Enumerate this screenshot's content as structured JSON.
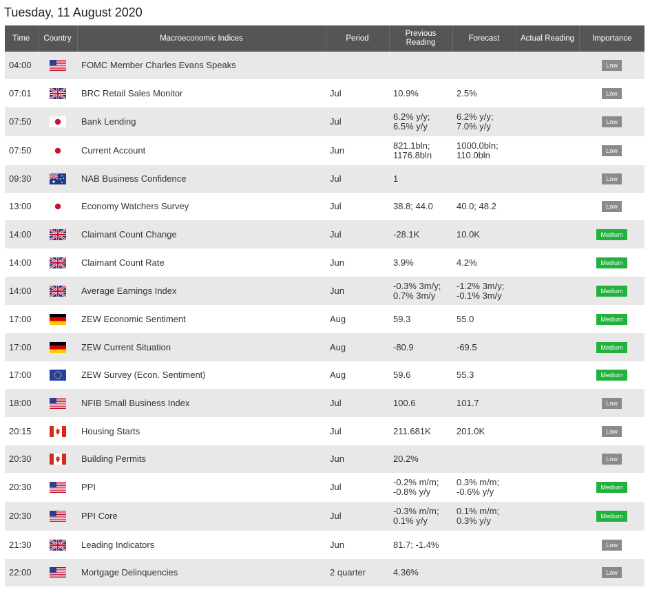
{
  "date_title": "Tuesday, 11 August 2020",
  "colors": {
    "header_bg": "#555555",
    "row_odd": "#e8e8e8",
    "row_even": "#ffffff",
    "low_badge": "#8a8a8a",
    "medium_badge": "#21b13d"
  },
  "columns": {
    "time": "Time",
    "country": "Country",
    "indices": "Macroeconomic Indices",
    "period": "Period",
    "previous_1": "Previous",
    "previous_2": "Reading",
    "forecast": "Forecast",
    "actual": "Actual Reading",
    "importance": "Importance"
  },
  "rows": [
    {
      "time": "04:00",
      "country": "us-flag-icon",
      "index": "FOMC Member Charles Evans Speaks",
      "period": "",
      "previous": [
        "",
        ""
      ],
      "forecast": [
        "",
        ""
      ],
      "actual": "",
      "importance": "Low"
    },
    {
      "time": "07:01",
      "country": "uk-flag-icon",
      "index": "BRC Retail Sales Monitor",
      "period": "Jul",
      "previous": [
        "10.9%",
        ""
      ],
      "forecast": [
        "2.5%",
        ""
      ],
      "actual": "",
      "importance": "Low"
    },
    {
      "time": "07:50",
      "country": "jp-flag-icon",
      "index": "Bank Lending",
      "period": "Jul",
      "previous": [
        "6.2% y/y;",
        "6.5% y/y"
      ],
      "forecast": [
        "6.2% y/y;",
        "7.0% y/y"
      ],
      "actual": "",
      "importance": "Low"
    },
    {
      "time": "07:50",
      "country": "jp-flag-icon",
      "index": "Current Account",
      "period": "Jun",
      "previous": [
        "821.1bln;",
        "1176.8bln"
      ],
      "forecast": [
        "1000.0bln;",
        "110.0bln"
      ],
      "actual": "",
      "importance": "Low"
    },
    {
      "time": "09:30",
      "country": "au-flag-icon",
      "index": "NAB Business Confidence",
      "period": "Jul",
      "previous": [
        "1",
        ""
      ],
      "forecast": [
        "",
        ""
      ],
      "actual": "",
      "importance": "Low"
    },
    {
      "time": "13:00",
      "country": "jp-flag-icon",
      "index": "Economy Watchers Survey",
      "period": "Jul",
      "previous": [
        "38.8; 44.0",
        ""
      ],
      "forecast": [
        "40.0; 48.2",
        ""
      ],
      "actual": "",
      "importance": "Low"
    },
    {
      "time": "14:00",
      "country": "uk-flag-icon",
      "index": "Claimant Count Change",
      "period": "Jul",
      "previous": [
        "-28.1K",
        ""
      ],
      "forecast": [
        "10.0K",
        ""
      ],
      "actual": "",
      "importance": "Medium"
    },
    {
      "time": "14:00",
      "country": "uk-flag-icon",
      "index": "Claimant Count Rate",
      "period": "Jun",
      "previous": [
        "3.9%",
        ""
      ],
      "forecast": [
        "4.2%",
        ""
      ],
      "actual": "",
      "importance": "Medium"
    },
    {
      "time": "14:00",
      "country": "uk-flag-icon",
      "index": "Average Earnings Index",
      "period": "Jun",
      "previous": [
        "-0.3% 3m/y;",
        "0.7% 3m/y"
      ],
      "forecast": [
        "-1.2% 3m/y;",
        "-0.1% 3m/y"
      ],
      "actual": "",
      "importance": "Medium"
    },
    {
      "time": "17:00",
      "country": "de-flag-icon",
      "index": "ZEW Economic Sentiment",
      "period": "Aug",
      "previous": [
        "59.3",
        ""
      ],
      "forecast": [
        "55.0",
        ""
      ],
      "actual": "",
      "importance": "Medium"
    },
    {
      "time": "17:00",
      "country": "de-flag-icon",
      "index": "ZEW Current Situation",
      "period": "Aug",
      "previous": [
        "-80.9",
        ""
      ],
      "forecast": [
        "-69.5",
        ""
      ],
      "actual": "",
      "importance": "Medium"
    },
    {
      "time": "17:00",
      "country": "eu-flag-icon",
      "index": "ZEW Survey (Econ. Sentiment)",
      "period": "Aug",
      "previous": [
        "59.6",
        ""
      ],
      "forecast": [
        "55.3",
        ""
      ],
      "actual": "",
      "importance": "Medium"
    },
    {
      "time": "18:00",
      "country": "us-flag-icon",
      "index": "NFIB Small Business Index",
      "period": "Jul",
      "previous": [
        "100.6",
        ""
      ],
      "forecast": [
        "101.7",
        ""
      ],
      "actual": "",
      "importance": "Low"
    },
    {
      "time": "20:15",
      "country": "ca-flag-icon",
      "index": "Housing Starts",
      "period": "Jul",
      "previous": [
        "211.681K",
        ""
      ],
      "forecast": [
        "201.0K",
        ""
      ],
      "actual": "",
      "importance": "Low"
    },
    {
      "time": "20:30",
      "country": "ca-flag-icon",
      "index": "Building Permits",
      "period": "Jun",
      "previous": [
        "20.2%",
        ""
      ],
      "forecast": [
        "",
        ""
      ],
      "actual": "",
      "importance": "Low"
    },
    {
      "time": "20:30",
      "country": "us-flag-icon",
      "index": "PPI",
      "period": "Jul",
      "previous": [
        "-0.2% m/m;",
        "-0.8% y/y"
      ],
      "forecast": [
        "0.3% m/m;",
        "-0.6% y/y"
      ],
      "actual": "",
      "importance": "Medium"
    },
    {
      "time": "20:30",
      "country": "us-flag-icon",
      "index": "PPI Core",
      "period": "Jul",
      "previous": [
        "-0.3% m/m;",
        "0.1% y/y"
      ],
      "forecast": [
        "0.1% m/m;",
        "0.3% y/y"
      ],
      "actual": "",
      "importance": "Medium"
    },
    {
      "time": "21:30",
      "country": "uk-flag-icon",
      "index": "Leading Indicators",
      "period": "Jun",
      "previous": [
        "81.7; -1.4%",
        ""
      ],
      "forecast": [
        "",
        ""
      ],
      "actual": "",
      "importance": "Low"
    },
    {
      "time": "22:00",
      "country": "us-flag-icon",
      "index": "Mortgage Delinquencies",
      "period": "2 quarter",
      "previous": [
        "4.36%",
        ""
      ],
      "forecast": [
        "",
        ""
      ],
      "actual": "",
      "importance": "Low"
    }
  ]
}
